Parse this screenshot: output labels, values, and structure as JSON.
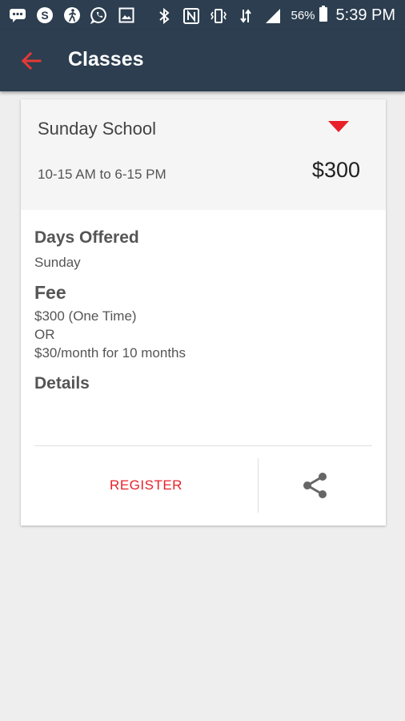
{
  "status_bar": {
    "icons": [
      "messages-icon",
      "skype-icon",
      "fitness-app-icon",
      "whatsapp-icon",
      "gallery-icon",
      "bluetooth-icon",
      "nfc-icon",
      "vibrate-icon",
      "data-icon",
      "signal-icon"
    ],
    "battery_percent": "56%",
    "time": "5:39 PM"
  },
  "app_bar": {
    "title": "Classes",
    "accent_color": "#e53935",
    "background_color": "#2c3e50"
  },
  "class_card": {
    "name": "Sunday School",
    "time": "10-15 AM to 6-15 PM",
    "price": "$300",
    "days_heading": "Days Offered",
    "days_value": "Sunday",
    "fee_heading": "Fee",
    "fee_lines": [
      "$300 (One Time)",
      "OR",
      "$30/month for 10 months"
    ],
    "details_heading": "Details",
    "register_label": "REGISTER"
  }
}
